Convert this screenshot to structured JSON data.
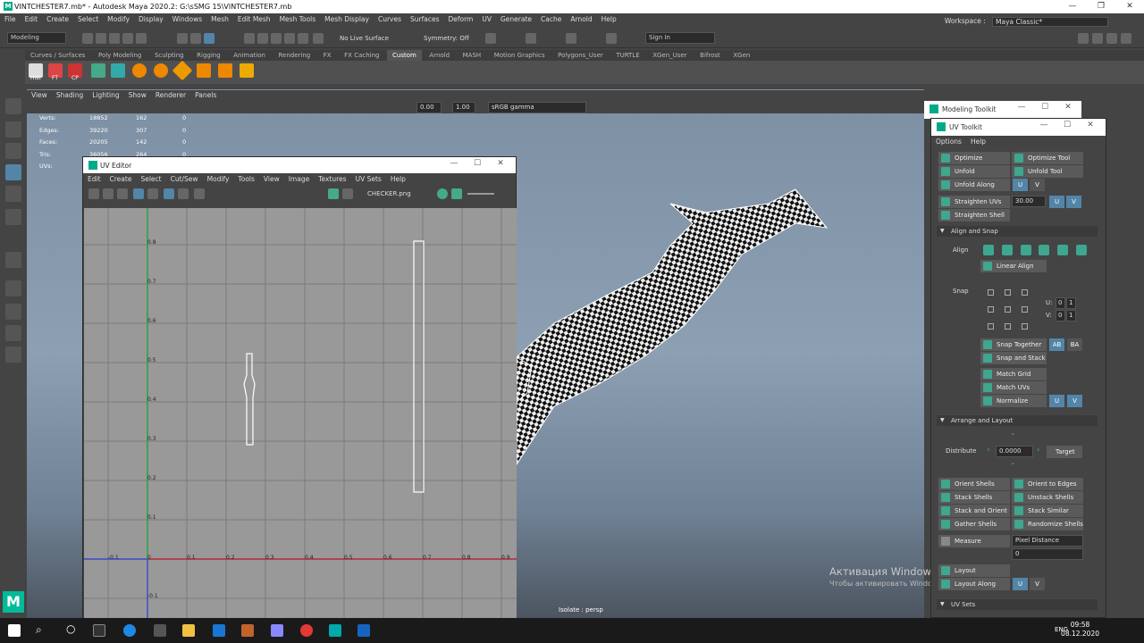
{
  "window": {
    "title": "VINTCHESTER7.mb* - Autodesk Maya 2020.2: G:\\sSMG 15\\VINTCHESTER7.mb"
  },
  "menubar": [
    "File",
    "Edit",
    "Create",
    "Select",
    "Modify",
    "Display",
    "Windows",
    "Mesh",
    "Edit Mesh",
    "Mesh Tools",
    "Mesh Display",
    "Curves",
    "Surfaces",
    "Deform",
    "UV",
    "Generate",
    "Cache",
    "Arnold",
    "Help"
  ],
  "workspace": {
    "label": "Workspace :",
    "value": "Maya Classic*"
  },
  "statusline": {
    "mode": "Modeling",
    "live_surface": "No Live Surface",
    "symmetry": "Symmetry: Off",
    "sign_in": "Sign In"
  },
  "shelf_tabs": [
    "Curves / Surfaces",
    "Poly Modeling",
    "Sculpting",
    "Rigging",
    "Animation",
    "Rendering",
    "FX",
    "FX Caching",
    "Custom",
    "Arnold",
    "MASH",
    "Motion Graphics",
    "Polygons_User",
    "TURTLE",
    "XGen_User",
    "Bifrost",
    "XGen"
  ],
  "shelf_active": "Custom",
  "shelf_labels": [
    "Hist",
    "FT",
    "CP"
  ],
  "viewport": {
    "menu": [
      "View",
      "Shading",
      "Lighting",
      "Show",
      "Renderer",
      "Panels"
    ],
    "exposure": "0.00",
    "gamma": "1.00",
    "colorspace": "sRGB gamma",
    "hud": [
      {
        "label": "Verts:",
        "a": "18852",
        "b": "162",
        "c": "0"
      },
      {
        "label": "Edges:",
        "a": "39220",
        "b": "307",
        "c": "0"
      },
      {
        "label": "Faces:",
        "a": "20205",
        "b": "142",
        "c": "0"
      },
      {
        "label": "Tris:",
        "a": "36056",
        "b": "264",
        "c": "0"
      },
      {
        "label": "UVs:",
        "a": "",
        "b": "",
        "c": ""
      }
    ],
    "isolate": "Isolate : persp"
  },
  "uv_editor": {
    "title": "UV Editor",
    "menu": [
      "Edit",
      "Create",
      "Select",
      "Cut/Sew",
      "Modify",
      "Tools",
      "View",
      "Image",
      "Textures",
      "UV Sets",
      "Help"
    ],
    "texture": "CHECKER.png",
    "y_ticks": [
      "0.8",
      "0.7",
      "0.6",
      "0.5",
      "0.4",
      "0.3",
      "0.2",
      "0.1",
      "-0.1"
    ],
    "x_ticks": [
      "-0.1",
      "0",
      "0.1",
      "0.2",
      "0.3",
      "0.4",
      "0.5",
      "0.6",
      "0.7",
      "0.8",
      "0.9"
    ]
  },
  "modeling_toolkit": {
    "title": "Modeling Toolkit"
  },
  "uv_toolkit": {
    "title": "UV Toolkit",
    "menu": [
      "Options",
      "Help"
    ],
    "optimize": "Optimize",
    "optimize_tool": "Optimize Tool",
    "unfold": "Unfold",
    "unfold_tool": "Unfold Tool",
    "unfold_along": "Unfold Along",
    "u": "U",
    "v": "V",
    "straighten_uvs": "Straighten UVs",
    "straighten_value": "30.00",
    "straighten_shell": "Straighten Shell",
    "align_snap": "Align and Snap",
    "align": "Align",
    "linear_align": "Linear Align",
    "snap": "Snap",
    "u_label": "U:",
    "v_label": "V:",
    "u_vals": [
      "0",
      "1"
    ],
    "v_vals": [
      "0",
      "1"
    ],
    "snap_together": "Snap Together",
    "ab": "AB",
    "ba": "BA",
    "snap_stack": "Snap and Stack",
    "match_grid": "Match Grid",
    "match_uvs": "Match UVs",
    "normalize": "Normalize",
    "arrange_layout": "Arrange and Layout",
    "distribute": "Distribute",
    "distribute_value": "0.0000",
    "target": "Target",
    "orient_shells": "Orient Shells",
    "orient_edges": "Orient to Edges",
    "stack_shells": "Stack Shells",
    "unstack_shells": "Unstack Shells",
    "stack_orient": "Stack and Orient",
    "stack_similar": "Stack Similar",
    "gather_shells": "Gather Shells",
    "randomize_shells": "Randomize Shells",
    "measure": "Measure",
    "measure_mode": "Pixel Distance",
    "measure_value": "0",
    "layout": "Layout",
    "layout_along": "Layout Along",
    "uv_sets": "UV Sets"
  },
  "activation": {
    "line1": "Активация Windows",
    "line2": "Чтобы активировать Windows, перейдите в раздел \"Параметры\"."
  },
  "taskbar": {
    "lang": "ENG",
    "time": "09:58",
    "date": "08.12.2020"
  }
}
